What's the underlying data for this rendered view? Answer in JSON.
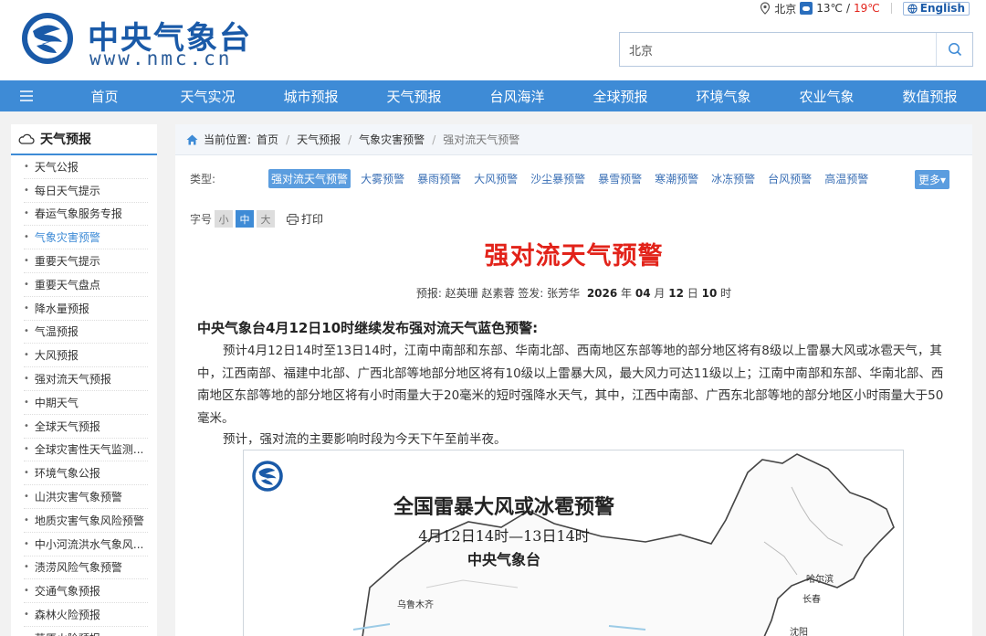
{
  "header": {
    "logo_cn": "中央气象台",
    "logo_en": "www.nmc.cn",
    "city": "北京",
    "temp_low": "13℃",
    "temp_sep": "/",
    "temp_high": "19℃",
    "english_label": "English",
    "search_value": "北京",
    "icons": [
      "location-icon",
      "weather-cloudy-icon",
      "globe-icon",
      "search-icon"
    ],
    "colors": {
      "brand": "#1a5aa8",
      "nav": "#3e8bd6",
      "alert": "#e2231a"
    }
  },
  "nav": {
    "items": [
      "首页",
      "天气实况",
      "城市预报",
      "天气预报",
      "台风海洋",
      "全球预报",
      "环境气象",
      "农业气象",
      "数值预报"
    ]
  },
  "sidebar": {
    "title": "天气预报",
    "items": [
      "天气公报",
      "每日天气提示",
      "春运气象服务专报",
      "气象灾害预警",
      "重要天气提示",
      "重要天气盘点",
      "降水量预报",
      "气温预报",
      "大风预报",
      "强对流天气预报",
      "中期天气",
      "全球天气预报",
      "全球灾害性天气监测...",
      "环境气象公报",
      "山洪灾害气象预警",
      "地质灾害气象风险预警",
      "中小河流洪水气象风...",
      "渍涝风险气象预警",
      "交通气象预报",
      "森林火险预报",
      "草原火险预报"
    ],
    "active_index": 3
  },
  "breadcrumb": {
    "label": "当前位置:",
    "items": [
      "首页",
      "天气预报",
      "气象灾害预警"
    ],
    "current": "强对流天气预警",
    "sep": "/"
  },
  "types": {
    "label": "类型:",
    "items": [
      "强对流天气预警",
      "大雾预警",
      "暴雨预警",
      "大风预警",
      "沙尘暴预警",
      "暴雪预警",
      "寒潮预警",
      "冰冻预警",
      "台风预警",
      "高温预警"
    ],
    "active_index": 0,
    "more": "更多▾"
  },
  "font_size": {
    "label": "字号",
    "small": "小",
    "medium": "中",
    "large": "大",
    "print": "打印"
  },
  "article": {
    "title": "强对流天气预警",
    "byline_prefix": "预报: 赵英珊 赵素蓉  签发: 张芳华",
    "year": "2026",
    "y_unit": "年",
    "month": "04",
    "m_unit": "月",
    "day": "12",
    "d_unit": "日",
    "hour": "10",
    "h_unit": "时",
    "lead": "中央气象台4月12日10时继续发布强对流天气蓝色预警:",
    "p1": "预计4月12日14时至13日14时，江南中南部和东部、华南北部、西南地区东部等地的部分地区将有8级以上雷暴大风或冰雹天气，其中，江西南部、福建中北部、广西北部等地部分地区将有10级以上雷暴大风，最大风力可达11级以上；江南中南部和东部、华南北部、西南地区东部等地的部分地区将有小时雨量大于20毫米的短时强降水天气，其中，江西中南部、广西东北部等地的部分地区小时雨量大于50毫米。",
    "p2": "预计，强对流的主要影响时段为今天下午至前半夜。"
  },
  "map": {
    "title": "全国雷暴大风或冰雹预警",
    "subtitle": "4月12日14时—13日14时",
    "agency": "中央气象台",
    "cities": [
      "乌鲁木齐",
      "哈尔滨",
      "长春",
      "沈阳"
    ]
  }
}
